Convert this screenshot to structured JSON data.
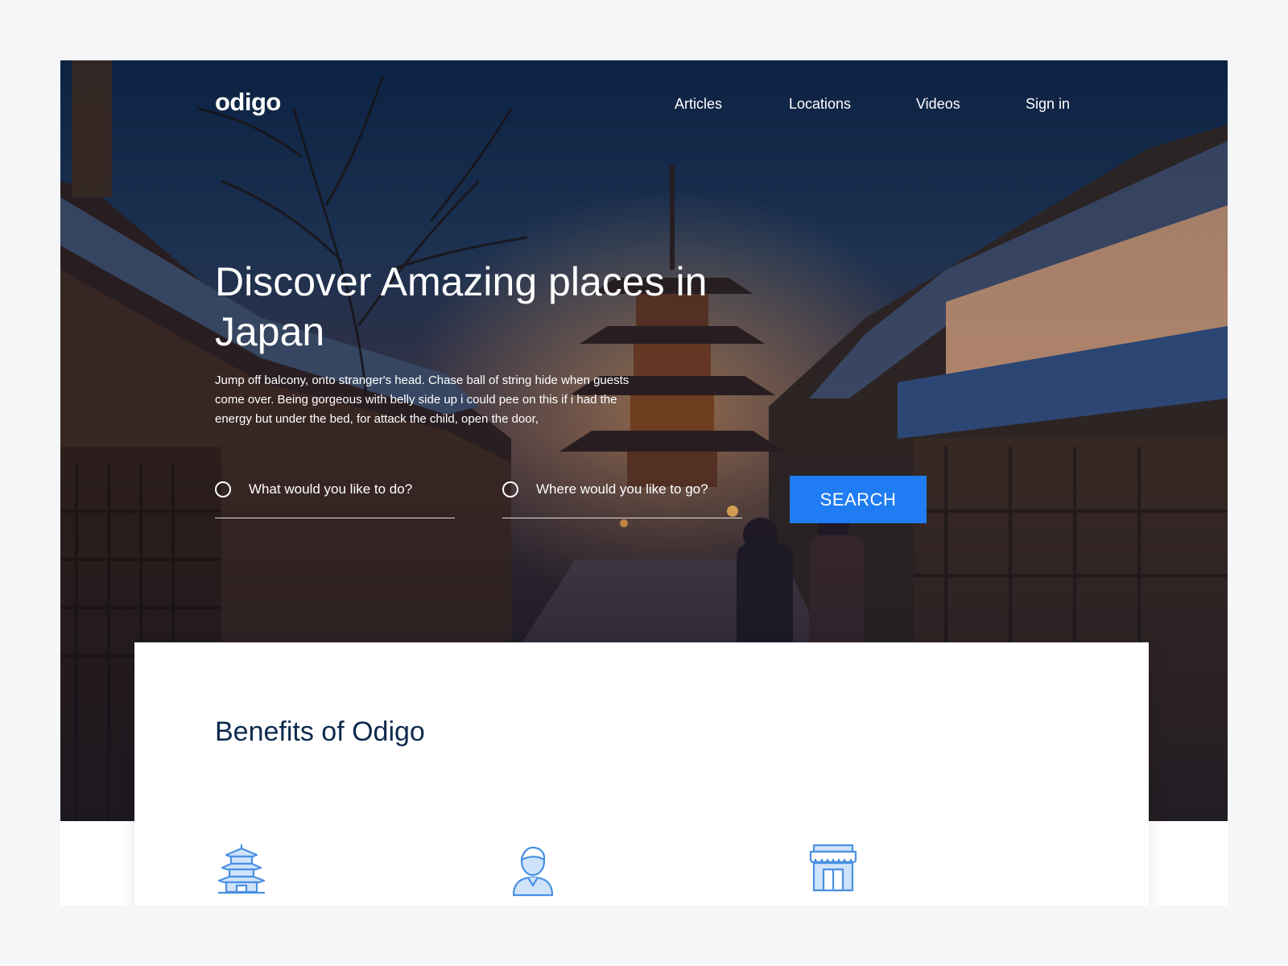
{
  "brand": {
    "logo_text": "odigo"
  },
  "nav": {
    "items": [
      {
        "label": "Articles"
      },
      {
        "label": "Locations"
      },
      {
        "label": "Videos"
      },
      {
        "label": "Sign in"
      }
    ]
  },
  "hero": {
    "headline": "Discover Amazing places in Japan",
    "intro": "Jump off balcony, onto stranger's head. Chase ball of string hide when guests come over. Being gorgeous with belly side up i could pee on this if i had the energy but under the bed, for attack the child, open the door,",
    "search": {
      "activity_placeholder": "What would you like to do?",
      "destination_placeholder": "Where would you like to go?",
      "button_label": "SEARCH"
    }
  },
  "benefits": {
    "title": "Benefits of Odigo",
    "icons": [
      "pagoda-icon",
      "person-icon",
      "shop-icon"
    ]
  },
  "colors": {
    "accent": "#1f7cf2",
    "heading": "#0e2a4d",
    "icon": "#4a90e2",
    "page_bg": "#f5f6f8"
  }
}
